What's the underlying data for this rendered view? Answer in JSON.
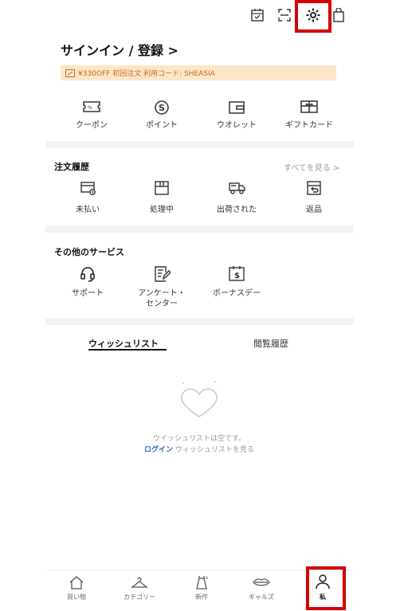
{
  "header": {
    "title": "サインイン / 登録 >",
    "promo": {
      "text": "¥330OFF 初回注文 利用コード: SHEASIA",
      "icon": "coupon-icon"
    },
    "top_icons": [
      "calendar-check-icon",
      "scan-icon",
      "gear-icon",
      "bag-icon"
    ]
  },
  "quick_links": [
    {
      "label": "クーポン",
      "icon": "coupon-icon"
    },
    {
      "label": "ポイント",
      "icon": "points-icon"
    },
    {
      "label": "ウオレット",
      "icon": "wallet-icon"
    },
    {
      "label": "ギフトカード",
      "icon": "gift-card-icon"
    }
  ],
  "orders": {
    "title": "注文履歴",
    "see_all": "すべてを見る >",
    "items": [
      {
        "label": "未払い",
        "icon": "unpaid-icon"
      },
      {
        "label": "処理中",
        "icon": "processing-icon"
      },
      {
        "label": "出荷された",
        "icon": "truck-icon"
      },
      {
        "label": "返品",
        "icon": "return-icon"
      }
    ]
  },
  "services": {
    "title": "その他のサービス",
    "items": [
      {
        "label": "サポート",
        "icon": "headset-icon"
      },
      {
        "label": "アンケート・",
        "label2": "センター",
        "icon": "survey-icon"
      },
      {
        "label": "ボーナスデー",
        "icon": "bonus-day-icon"
      }
    ]
  },
  "tabs": {
    "wishlist": "ウィッシュリスト",
    "history": "閲覧履歴"
  },
  "wishlist_empty": {
    "message": "ウイッシュリストは空です。",
    "login": "ログイン",
    "login_suffix": " ウィッシュリストを見る"
  },
  "bottom_nav": [
    {
      "label": "買い物",
      "icon": "home-icon"
    },
    {
      "label": "カテゴリー",
      "icon": "hanger-icon"
    },
    {
      "label": "新作",
      "icon": "dress-icon"
    },
    {
      "label": "ギャルズ",
      "icon": "lips-icon"
    },
    {
      "label": "私",
      "icon": "person-icon"
    }
  ],
  "colors": {
    "promo_bg": "#fde6c8",
    "promo_text": "#c56a1b",
    "link_blue": "#2b62c6",
    "highlight_red": "#d40000"
  }
}
